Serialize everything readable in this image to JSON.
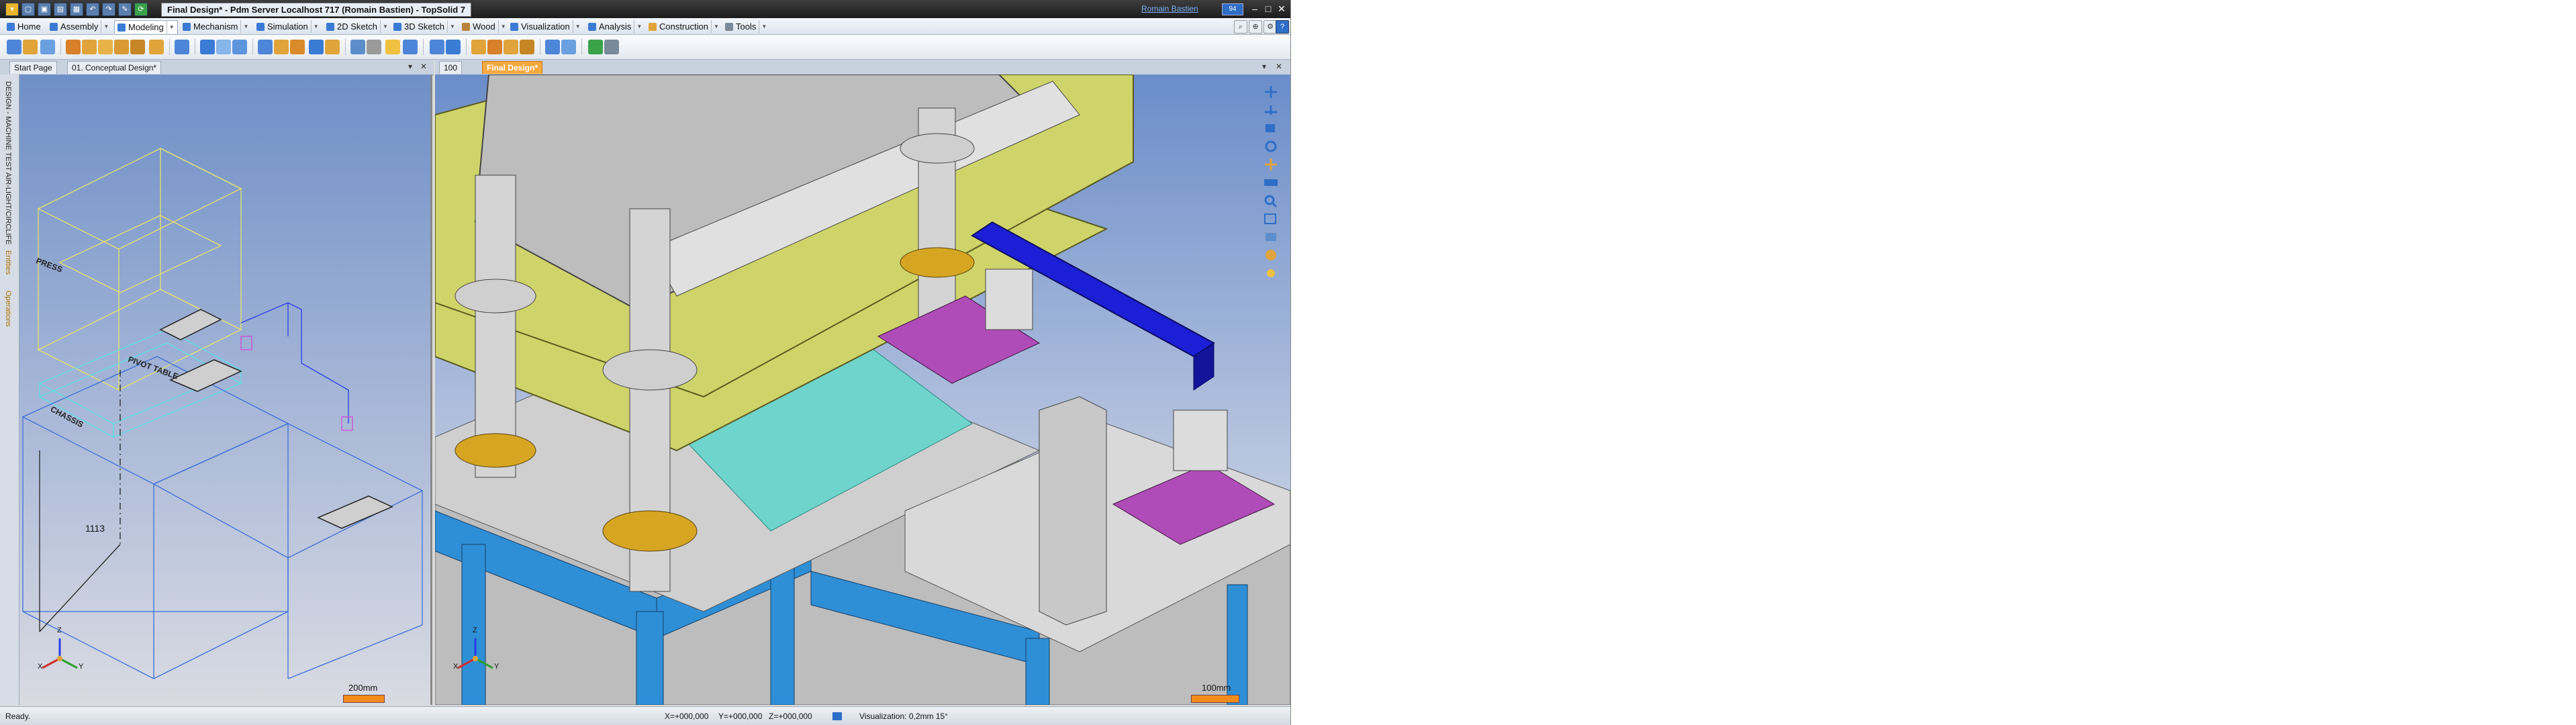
{
  "window": {
    "title": "Final Design* - Pdm Server Localhost 717 (Romain Bastien) - TopSolid 7",
    "user": "Romain Bastien",
    "user_badge": "94"
  },
  "menu": {
    "tabs": [
      {
        "label": "Home"
      },
      {
        "label": "Assembly"
      },
      {
        "label": "Modeling"
      },
      {
        "label": "Mechanism"
      },
      {
        "label": "Simulation"
      },
      {
        "label": "2D Sketch"
      },
      {
        "label": "3D Sketch"
      },
      {
        "label": "Wood"
      },
      {
        "label": "Visualization"
      },
      {
        "label": "Analysis"
      },
      {
        "label": "Construction"
      },
      {
        "label": "Tools"
      }
    ]
  },
  "left_pane": {
    "tabs": [
      "Start Page",
      "01. Conceptual Design*"
    ],
    "side_labels": [
      "DESIGN - MACHINE TEST AIR-LIGHT/CIRCLIFE",
      "Entities",
      "Operations"
    ],
    "sketch_labels": {
      "press": "PRESS",
      "pivot_table": "PIVOT TABLE",
      "chassis": "CHASSIS",
      "dimension": "1113"
    },
    "scale": "200mm"
  },
  "right_pane": {
    "tabs": [
      "100",
      "Final Design*"
    ],
    "scale": "100mm"
  },
  "triad": {
    "x": "X",
    "y": "Y",
    "z": "Z"
  },
  "status": {
    "ready": "Ready.",
    "x": "X=+000,000",
    "y": "Y=+000,000",
    "z": "Z=+000,000",
    "visualization": "Visualization: 0,2mm 15°"
  },
  "colors": {
    "accent": "#f7a93f",
    "yellow_plate": "#cfd46a",
    "purple": "#b04cb8",
    "cyan": "#6fd4cc",
    "blue_frame": "#2f8fd6",
    "blue_beam": "#1c1fd6"
  }
}
